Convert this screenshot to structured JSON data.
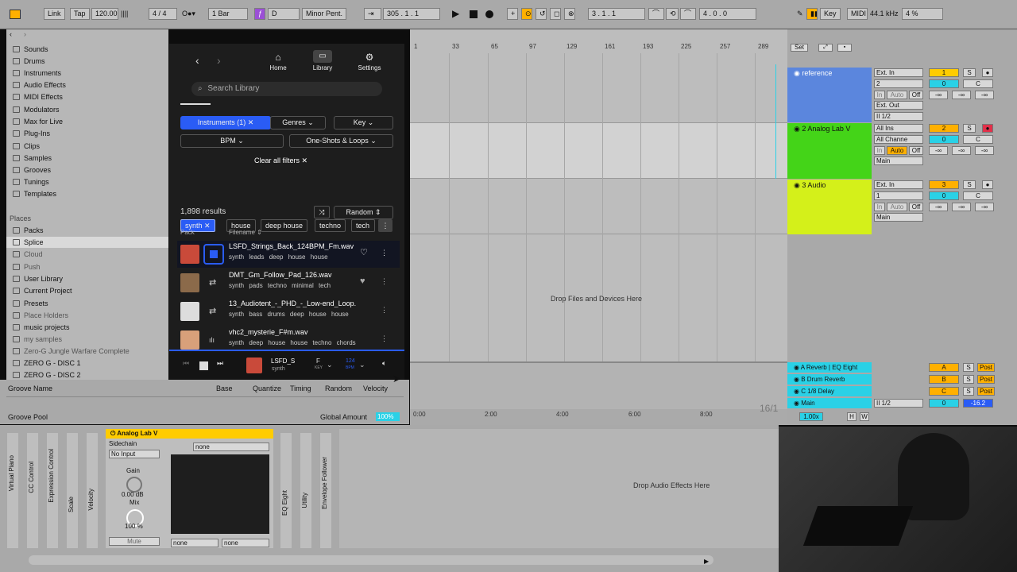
{
  "transport": {
    "link": "Link",
    "tap": "Tap",
    "tempo": "120.00",
    "time_sig_num": "4",
    "time_sig_den": "4",
    "quantize": "1 Bar",
    "key": "D",
    "scale": "Minor Pent.",
    "position": "305 .   1 .   1",
    "loop_start": "3 .   1 .   1",
    "loop_length": "4 .   0 .   0",
    "key_label": "Key",
    "midi_label": "MIDI",
    "sample_rate": "44.1 kHz",
    "cpu": "4 %"
  },
  "sidebar": {
    "categories": [
      "Sounds",
      "Drums",
      "Instruments",
      "Audio Effects",
      "MIDI Effects",
      "Modulators",
      "Max for Live",
      "Plug-Ins",
      "Clips",
      "Samples",
      "Grooves",
      "Tunings",
      "Templates"
    ],
    "places_heading": "Places",
    "places": [
      "Packs",
      "Splice",
      "Cloud",
      "Push",
      "User Library",
      "Current Project",
      "Presets",
      "Place Holders",
      "music projects",
      "my samples",
      "Zero-G Jungle Warfare Complete",
      "ZERO G - DISC 1",
      "ZERO G - DISC 2"
    ]
  },
  "splice": {
    "nav": {
      "home": "Home",
      "library": "Library",
      "settings": "Settings"
    },
    "search_placeholder": "Search Library",
    "filters": {
      "instruments": "Instruments (1)",
      "genres": "Genres",
      "key": "Key",
      "bpm": "BPM",
      "one_shots": "One-Shots & Loops",
      "clear": "Clear all filters"
    },
    "tags": [
      "synth",
      "house",
      "deep house",
      "techno",
      "tech"
    ],
    "results": "1,898 results",
    "sort": "Random",
    "col_pack": "Pack",
    "col_filename": "Filename",
    "rows": [
      {
        "name": "LSFD_Strings_Back_124BPM_Fm.wav",
        "tags": "synth leads deep house house"
      },
      {
        "name": "DMT_Gm_Follow_Pad_126.wav",
        "tags": "synth pads techno minimal tech"
      },
      {
        "name": "13_Audiotent_-_PHD_-_Low-end_Loop.wav",
        "tags": "synth bass drums deep house house"
      },
      {
        "name": "vhc2_mysterie_F#m.wav",
        "tags": "synth deep house house techno chords"
      }
    ],
    "player": {
      "name": "LSFD_S",
      "tag": "synth",
      "key": "F",
      "key_label": "KEY",
      "bpm": "124",
      "bpm_label": "BPM"
    }
  },
  "groove": {
    "cols": [
      "Groove Name",
      "Base",
      "Quantize",
      "Timing",
      "Random",
      "Velocity"
    ],
    "pool": "Groove Pool",
    "global_amount_label": "Global Amount",
    "global_amount": "100%"
  },
  "arrangement": {
    "ruler": [
      "1",
      "33",
      "65",
      "97",
      "129",
      "161",
      "193",
      "225",
      "257",
      "289"
    ],
    "drop_text": "Drop Files and Devices Here",
    "time_ruler": [
      "0:00",
      "2:00",
      "4:00",
      "6:00",
      "8:00"
    ],
    "loop_label": "16/1"
  },
  "tracks": [
    {
      "name": "reference",
      "color": "#5b86dd",
      "input": "Ext. In",
      "ch": "2",
      "out": "Ext. Out",
      "sub": "II 1/2",
      "num": "1",
      "vol": "0",
      "pan": "C"
    },
    {
      "name": "2 Analog Lab V",
      "color": "#44d418",
      "input": "All Ins",
      "ch": "All Channe",
      "out": "Main",
      "num": "2",
      "vol": "0",
      "pan": "C"
    },
    {
      "name": "3 Audio",
      "color": "#d4f01a",
      "input": "Ext. In",
      "ch": "1",
      "out": "Main",
      "num": "3",
      "vol": "0",
      "pan": "C"
    }
  ],
  "returns": [
    {
      "name": "A Reverb | EQ Eight",
      "letter": "A"
    },
    {
      "name": "B Drum Reverb",
      "letter": "B"
    },
    {
      "name": "C 1/8 Delay",
      "letter": "C"
    },
    {
      "name": "Main",
      "letter": "0",
      "out": "II 1/2",
      "vol": "-16.2"
    }
  ],
  "monitor": {
    "in": "In",
    "auto": "Auto",
    "off": "Off",
    "inf": "-∞",
    "set": "Set",
    "post": "Post",
    "s": "S",
    "speed": "1.00x",
    "h": "H",
    "w": "W"
  },
  "devices": {
    "strips": [
      "Virtual Piano",
      "CC Control",
      "Expression Control",
      "Scale",
      "Velocity"
    ],
    "instrument": {
      "title": "Analog Lab V",
      "sidechain": "Sidechain",
      "no_input": "No Input",
      "preset": "none",
      "gain_label": "Gain",
      "gain": "0.00 dB",
      "mix_label": "Mix",
      "mix": "100 %",
      "mute": "Mute",
      "none": "none"
    },
    "post": [
      "EQ Eight",
      "Utility",
      "Envelope Follower"
    ],
    "drop_audio": "Drop Audio Effects Here"
  }
}
